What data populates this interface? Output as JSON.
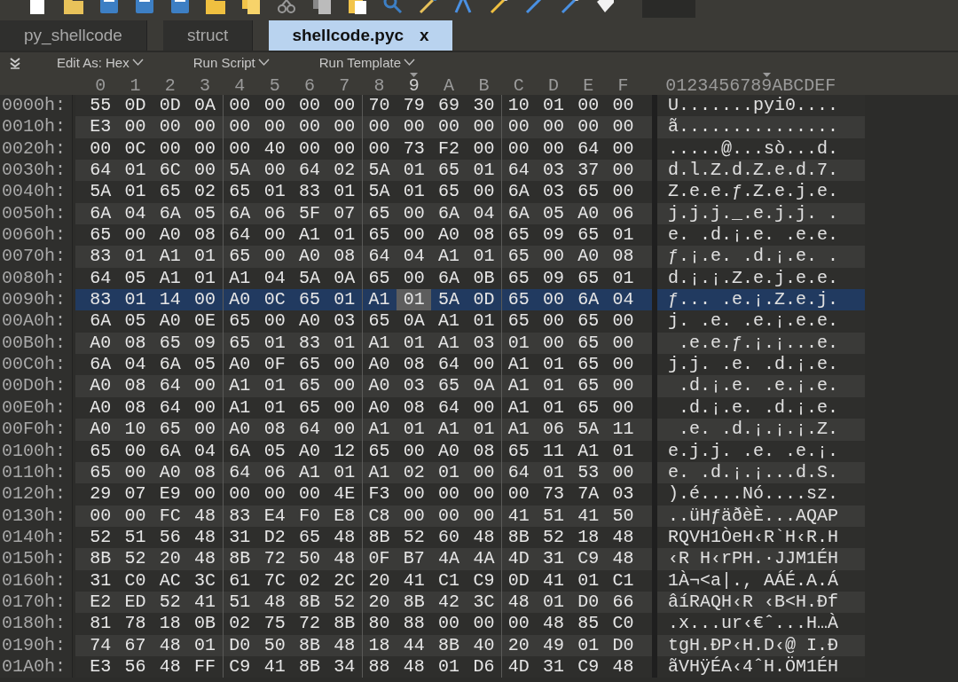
{
  "tabs": [
    {
      "label": "py_shellcode",
      "selected": false
    },
    {
      "label": "struct",
      "selected": false
    },
    {
      "label": "shellcode.pyc",
      "selected": true,
      "close": "x"
    }
  ],
  "toolbar": [
    {
      "label": "Edit As: Hex"
    },
    {
      "label": "Run Script"
    },
    {
      "label": "Run Template"
    }
  ],
  "columns": [
    {
      "label": "0",
      "selected": false
    },
    {
      "label": "1",
      "selected": false
    },
    {
      "label": "2",
      "selected": false
    },
    {
      "label": "3",
      "selected": false
    },
    {
      "label": "4",
      "selected": false
    },
    {
      "label": "5",
      "selected": false
    },
    {
      "label": "6",
      "selected": false
    },
    {
      "label": "7",
      "selected": false
    },
    {
      "label": "8",
      "selected": false
    },
    {
      "label": "9",
      "selected": true
    },
    {
      "label": "A",
      "selected": false
    },
    {
      "label": "B",
      "selected": false
    },
    {
      "label": "C",
      "selected": false
    },
    {
      "label": "D",
      "selected": false
    },
    {
      "label": "E",
      "selected": false
    },
    {
      "label": "F",
      "selected": false
    }
  ],
  "ascii_header": "0123456789ABCDEF",
  "rows": [
    {
      "offset": "0000h:",
      "bytes": [
        "55",
        "0D",
        "0D",
        "0A",
        "00",
        "00",
        "00",
        "00",
        "70",
        "79",
        "69",
        "30",
        "10",
        "01",
        "00",
        "00"
      ],
      "ascii": "U.......pyi0....",
      "selected": false
    },
    {
      "offset": "0010h:",
      "bytes": [
        "E3",
        "00",
        "00",
        "00",
        "00",
        "00",
        "00",
        "00",
        "00",
        "00",
        "00",
        "00",
        "00",
        "00",
        "00",
        "00"
      ],
      "ascii": "ã...............",
      "selected": false
    },
    {
      "offset": "0020h:",
      "bytes": [
        "00",
        "0C",
        "00",
        "00",
        "00",
        "40",
        "00",
        "00",
        "00",
        "73",
        "F2",
        "00",
        "00",
        "00",
        "64",
        "00"
      ],
      "ascii": ".....@...sò...d.",
      "selected": false
    },
    {
      "offset": "0030h:",
      "bytes": [
        "64",
        "01",
        "6C",
        "00",
        "5A",
        "00",
        "64",
        "02",
        "5A",
        "01",
        "65",
        "01",
        "64",
        "03",
        "37",
        "00"
      ],
      "ascii": "d.l.Z.d.Z.e.d.7.",
      "selected": false
    },
    {
      "offset": "0040h:",
      "bytes": [
        "5A",
        "01",
        "65",
        "02",
        "65",
        "01",
        "83",
        "01",
        "5A",
        "01",
        "65",
        "00",
        "6A",
        "03",
        "65",
        "00"
      ],
      "ascii": "Z.e.e.ƒ.Z.e.j.e.",
      "selected": false
    },
    {
      "offset": "0050h:",
      "bytes": [
        "6A",
        "04",
        "6A",
        "05",
        "6A",
        "06",
        "5F",
        "07",
        "65",
        "00",
        "6A",
        "04",
        "6A",
        "05",
        "A0",
        "06"
      ],
      "ascii": "j.j.j._.e.j.j. .",
      "selected": false
    },
    {
      "offset": "0060h:",
      "bytes": [
        "65",
        "00",
        "A0",
        "08",
        "64",
        "00",
        "A1",
        "01",
        "65",
        "00",
        "A0",
        "08",
        "65",
        "09",
        "65",
        "01"
      ],
      "ascii": "e. .d.¡.e. .e.e.",
      "selected": false
    },
    {
      "offset": "0070h:",
      "bytes": [
        "83",
        "01",
        "A1",
        "01",
        "65",
        "00",
        "A0",
        "08",
        "64",
        "04",
        "A1",
        "01",
        "65",
        "00",
        "A0",
        "08"
      ],
      "ascii": "ƒ.¡.e. .d.¡.e. .",
      "selected": false
    },
    {
      "offset": "0080h:",
      "bytes": [
        "64",
        "05",
        "A1",
        "01",
        "A1",
        "04",
        "5A",
        "0A",
        "65",
        "00",
        "6A",
        "0B",
        "65",
        "09",
        "65",
        "01"
      ],
      "ascii": "d.¡.¡.Z.e.j.e.e.",
      "selected": false
    },
    {
      "offset": "0090h:",
      "bytes": [
        "83",
        "01",
        "14",
        "00",
        "A0",
        "0C",
        "65",
        "01",
        "A1",
        "01",
        "5A",
        "0D",
        "65",
        "00",
        "6A",
        "04"
      ],
      "ascii": "ƒ... .e.¡.Z.e.j.",
      "selected": true
    },
    {
      "offset": "00A0h:",
      "bytes": [
        "6A",
        "05",
        "A0",
        "0E",
        "65",
        "00",
        "A0",
        "03",
        "65",
        "0A",
        "A1",
        "01",
        "65",
        "00",
        "65",
        "00"
      ],
      "ascii": "j. .e. .e.¡.e.e.",
      "selected": false
    },
    {
      "offset": "00B0h:",
      "bytes": [
        "A0",
        "08",
        "65",
        "09",
        "65",
        "01",
        "83",
        "01",
        "A1",
        "01",
        "A1",
        "03",
        "01",
        "00",
        "65",
        "00"
      ],
      "ascii": " .e.e.ƒ.¡.¡...e.",
      "selected": false
    },
    {
      "offset": "00C0h:",
      "bytes": [
        "6A",
        "04",
        "6A",
        "05",
        "A0",
        "0F",
        "65",
        "00",
        "A0",
        "08",
        "64",
        "00",
        "A1",
        "01",
        "65",
        "00"
      ],
      "ascii": "j.j. .e. .d.¡.e.",
      "selected": false
    },
    {
      "offset": "00D0h:",
      "bytes": [
        "A0",
        "08",
        "64",
        "00",
        "A1",
        "01",
        "65",
        "00",
        "A0",
        "03",
        "65",
        "0A",
        "A1",
        "01",
        "65",
        "00"
      ],
      "ascii": " .d.¡.e. .e.¡.e.",
      "selected": false
    },
    {
      "offset": "00E0h:",
      "bytes": [
        "A0",
        "08",
        "64",
        "00",
        "A1",
        "01",
        "65",
        "00",
        "A0",
        "08",
        "64",
        "00",
        "A1",
        "01",
        "65",
        "00"
      ],
      "ascii": " .d.¡.e. .d.¡.e.",
      "selected": false
    },
    {
      "offset": "00F0h:",
      "bytes": [
        "A0",
        "10",
        "65",
        "00",
        "A0",
        "08",
        "64",
        "00",
        "A1",
        "01",
        "A1",
        "01",
        "A1",
        "06",
        "5A",
        "11"
      ],
      "ascii": " .e. .d.¡.¡.¡.Z.",
      "selected": false
    },
    {
      "offset": "0100h:",
      "bytes": [
        "65",
        "00",
        "6A",
        "04",
        "6A",
        "05",
        "A0",
        "12",
        "65",
        "00",
        "A0",
        "08",
        "65",
        "11",
        "A1",
        "01"
      ],
      "ascii": "e.j.j. .e. .e.¡.",
      "selected": false
    },
    {
      "offset": "0110h:",
      "bytes": [
        "65",
        "00",
        "A0",
        "08",
        "64",
        "06",
        "A1",
        "01",
        "A1",
        "02",
        "01",
        "00",
        "64",
        "01",
        "53",
        "00"
      ],
      "ascii": "e. .d.¡.¡...d.S.",
      "selected": false
    },
    {
      "offset": "0120h:",
      "bytes": [
        "29",
        "07",
        "E9",
        "00",
        "00",
        "00",
        "00",
        "4E",
        "F3",
        "00",
        "00",
        "00",
        "00",
        "73",
        "7A",
        "03"
      ],
      "ascii": ").é....Nó....sz.",
      "selected": false
    },
    {
      "offset": "0130h:",
      "bytes": [
        "00",
        "00",
        "FC",
        "48",
        "83",
        "E4",
        "F0",
        "E8",
        "C8",
        "00",
        "00",
        "00",
        "41",
        "51",
        "41",
        "50"
      ],
      "ascii": "..üHƒäðèÈ...AQAP",
      "selected": false
    },
    {
      "offset": "0140h:",
      "bytes": [
        "52",
        "51",
        "56",
        "48",
        "31",
        "D2",
        "65",
        "48",
        "8B",
        "52",
        "60",
        "48",
        "8B",
        "52",
        "18",
        "48"
      ],
      "ascii": "RQVH1ÒeH‹R`H‹R.H",
      "selected": false
    },
    {
      "offset": "0150h:",
      "bytes": [
        "8B",
        "52",
        "20",
        "48",
        "8B",
        "72",
        "50",
        "48",
        "0F",
        "B7",
        "4A",
        "4A",
        "4D",
        "31",
        "C9",
        "48"
      ],
      "ascii": "‹R H‹rPH.·JJM1ÉH",
      "selected": false
    },
    {
      "offset": "0160h:",
      "bytes": [
        "31",
        "C0",
        "AC",
        "3C",
        "61",
        "7C",
        "02",
        "2C",
        "20",
        "41",
        "C1",
        "C9",
        "0D",
        "41",
        "01",
        "C1"
      ],
      "ascii": "1À¬<a|., AÁÉ.A.Á",
      "selected": false
    },
    {
      "offset": "0170h:",
      "bytes": [
        "E2",
        "ED",
        "52",
        "41",
        "51",
        "48",
        "8B",
        "52",
        "20",
        "8B",
        "42",
        "3C",
        "48",
        "01",
        "D0",
        "66"
      ],
      "ascii": "âíRAQH‹R ‹B<H.Ðf",
      "selected": false
    },
    {
      "offset": "0180h:",
      "bytes": [
        "81",
        "78",
        "18",
        "0B",
        "02",
        "75",
        "72",
        "8B",
        "80",
        "88",
        "00",
        "00",
        "00",
        "48",
        "85",
        "C0"
      ],
      "ascii": ".x...ur‹€ˆ...H…À",
      "selected": false
    },
    {
      "offset": "0190h:",
      "bytes": [
        "74",
        "67",
        "48",
        "01",
        "D0",
        "50",
        "8B",
        "48",
        "18",
        "44",
        "8B",
        "40",
        "20",
        "49",
        "01",
        "D0"
      ],
      "ascii": "tgH.ÐP‹H.D‹@ I.Ð",
      "selected": false
    },
    {
      "offset": "01A0h:",
      "bytes": [
        "E3",
        "56",
        "48",
        "FF",
        "C9",
        "41",
        "8B",
        "34",
        "88",
        "48",
        "01",
        "D6",
        "4D",
        "31",
        "C9",
        "48"
      ],
      "ascii": "ãVHÿÉA‹4ˆH.ÖM1ÉH",
      "selected": false
    }
  ]
}
